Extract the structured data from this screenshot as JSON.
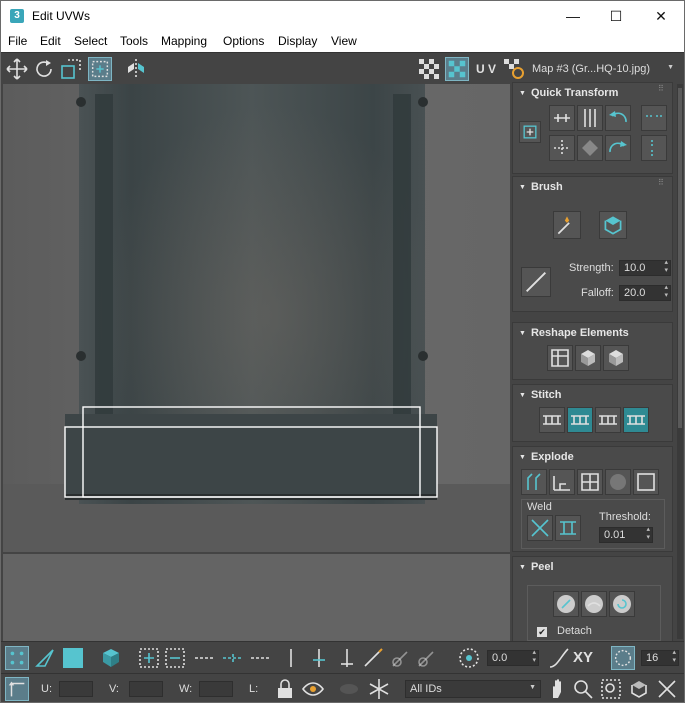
{
  "window": {
    "title": "Edit UVWs",
    "app_icon": "3",
    "minimize": "—",
    "maximize": "☐",
    "close": "✕"
  },
  "menu": [
    "File",
    "Edit",
    "Select",
    "Tools",
    "Mapping",
    "Options",
    "Display",
    "View"
  ],
  "toolbar": {
    "uv_label": "U V",
    "map_select": "Map #3 (Gr...HQ-10.jpg)"
  },
  "panels": {
    "quick_transform": {
      "title": "Quick Transform"
    },
    "brush": {
      "title": "Brush",
      "strength_label": "Strength:",
      "strength_value": "10.0",
      "falloff_label": "Falloff:",
      "falloff_value": "20.0"
    },
    "reshape": {
      "title": "Reshape Elements"
    },
    "stitch": {
      "title": "Stitch"
    },
    "explode": {
      "title": "Explode",
      "weld_label": "Weld",
      "threshold_label": "Threshold:",
      "threshold_value": "0.01"
    },
    "peel": {
      "title": "Peel",
      "detach_label": "Detach",
      "detach_checked": true
    }
  },
  "bottom": {
    "spinner_value": "0.0",
    "xy_label": "XY",
    "count_value": "16",
    "u_label": "U:",
    "v_label": "V:",
    "w_label": "W:",
    "l_label": "L:",
    "ids_select": "All IDs"
  },
  "colors": {
    "accent": "#56c4cf",
    "panel_bg": "#4a4a4a",
    "viewport_bg": "#606060"
  }
}
